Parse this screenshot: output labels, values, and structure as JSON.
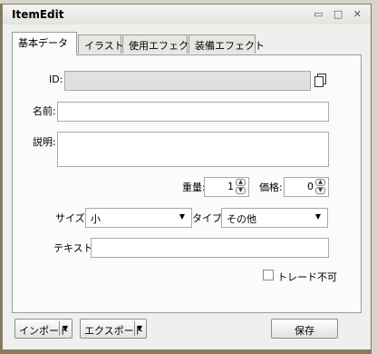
{
  "window": {
    "title": "ItemEdit",
    "controls": "▭ □ ✕"
  },
  "tabs": [
    "基本データ",
    "イラスト",
    "使用エフェクト",
    "装備エフェクト"
  ],
  "form": {
    "id_label": "ID:",
    "id_value": "",
    "name_label": "名前:",
    "name_value": "",
    "desc_label": "説明:",
    "desc_value": "",
    "weight_label": "重量:",
    "weight_value": "1",
    "price_label": "価格:",
    "price_value": "0",
    "size_label": "サイズ:",
    "size_value": "小",
    "type_label": "タイプ:",
    "type_value": "その他",
    "text_label": "テキスト:",
    "text_value": "",
    "no_trade_label": "トレード不可",
    "no_trade_checked": false
  },
  "footer": {
    "import_label": "インポート",
    "export_label": "エクスポート",
    "save_label": "保存"
  },
  "icons": {
    "copy": "copy-icon",
    "dropdown": "chevron-down-icon",
    "spin_up": "▲",
    "spin_down": "▼"
  }
}
